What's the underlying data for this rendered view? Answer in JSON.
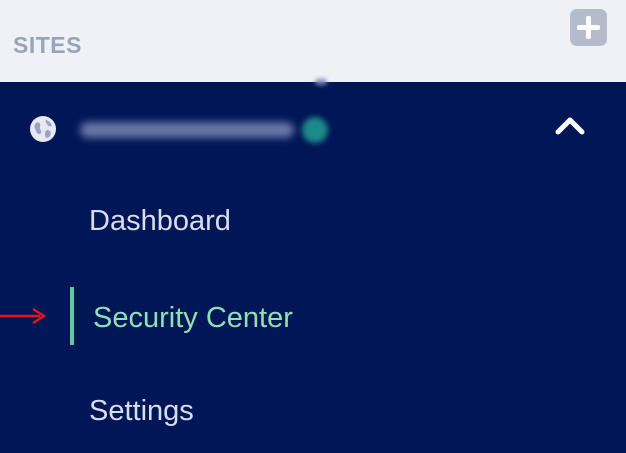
{
  "header": {
    "title": "SITES",
    "add_icon": "plus-icon"
  },
  "site": {
    "icon": "globe-icon",
    "toggle_icon": "chevron-up-icon",
    "expanded": true
  },
  "nav": {
    "items": [
      {
        "label": "Dashboard",
        "active": false
      },
      {
        "label": "Security Center",
        "active": true
      },
      {
        "label": "Settings",
        "active": false
      }
    ]
  },
  "annotation": {
    "arrow_color": "#e3141c"
  },
  "colors": {
    "sidebar_bg": "#001656",
    "header_bg": "#f0f1f6",
    "active_text": "#8fe0b5",
    "active_indicator": "#62c79a",
    "nav_text": "#d9dcea",
    "header_text": "#9aa3b8"
  }
}
